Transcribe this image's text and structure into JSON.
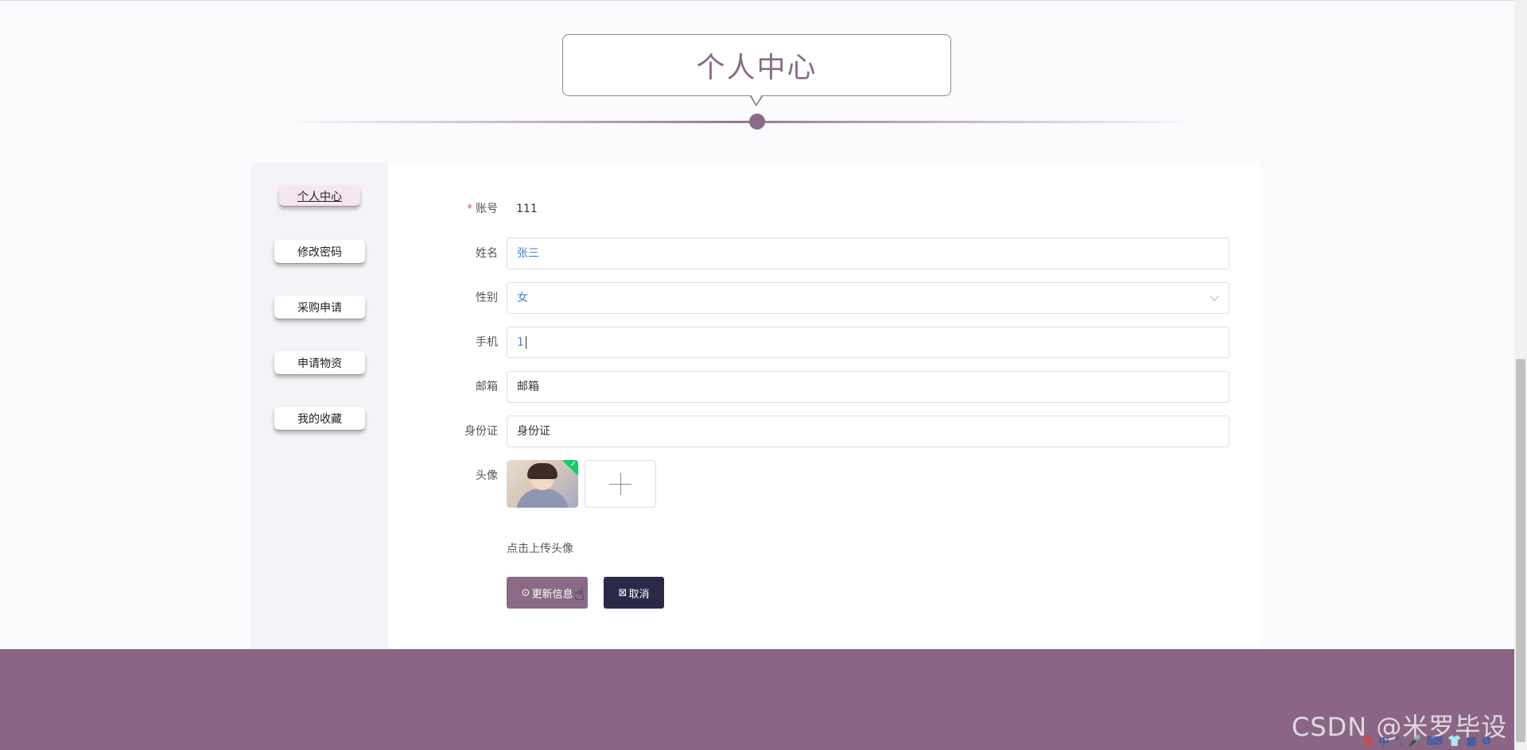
{
  "page": {
    "title": "个人中心"
  },
  "sidebar": {
    "items": [
      {
        "label": "个人中心",
        "active": true
      },
      {
        "label": "修改密码",
        "active": false
      },
      {
        "label": "采购申请",
        "active": false
      },
      {
        "label": "申请物资",
        "active": false
      },
      {
        "label": "我的收藏",
        "active": false
      }
    ]
  },
  "form": {
    "account": {
      "label": "账号",
      "value": "111",
      "required": true
    },
    "name": {
      "label": "姓名",
      "value": "张三"
    },
    "gender": {
      "label": "性别",
      "value": "女"
    },
    "phone": {
      "label": "手机",
      "value": "1"
    },
    "email": {
      "label": "邮箱",
      "placeholder": "邮箱"
    },
    "id_card": {
      "label": "身份证",
      "placeholder": "身份证"
    },
    "avatar": {
      "label": "头像",
      "upload_tip": "点击上传头像"
    }
  },
  "buttons": {
    "update": "更新信息",
    "cancel": "取消"
  },
  "footer": {
    "watermark": "CSDN @米罗毕设"
  },
  "tray": {
    "ime": "中",
    "items": [
      "S",
      "中",
      "°,",
      "🎤",
      "⌨",
      "👕",
      "▦",
      "⚙"
    ]
  },
  "colors": {
    "accent": "#8a6a86",
    "cancel": "#2a2a48",
    "footer": "#8a6684",
    "success": "#13ce66"
  }
}
